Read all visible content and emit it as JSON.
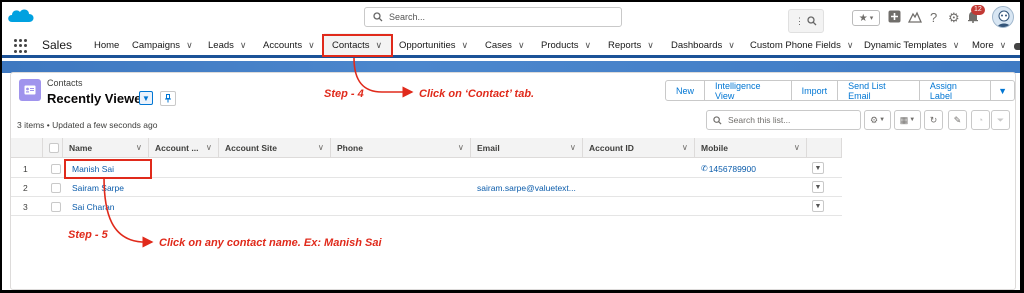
{
  "search": {
    "placeholder": "Search..."
  },
  "app": {
    "name": "Sales"
  },
  "notifications": {
    "count": "12"
  },
  "nav": {
    "items": [
      {
        "label": "Home",
        "chevron": false
      },
      {
        "label": "Campaigns",
        "chevron": true
      },
      {
        "label": "Leads",
        "chevron": true
      },
      {
        "label": "Accounts",
        "chevron": true
      },
      {
        "label": "Contacts",
        "chevron": true,
        "active": true
      },
      {
        "label": "Opportunities",
        "chevron": true
      },
      {
        "label": "Cases",
        "chevron": true
      },
      {
        "label": "Products",
        "chevron": true
      },
      {
        "label": "Reports",
        "chevron": true
      },
      {
        "label": "Dashboards",
        "chevron": true
      },
      {
        "label": "Custom Phone Fields",
        "chevron": true
      },
      {
        "label": "Dynamic Templates",
        "chevron": true
      },
      {
        "label": "More",
        "chevron": true
      }
    ]
  },
  "list": {
    "object_label": "Contacts",
    "view_name": "Recently Viewed",
    "status": "3 items • Updated a few seconds ago",
    "search_placeholder": "Search this list...",
    "buttons": [
      "New",
      "Intelligence View",
      "Import",
      "Send List Email",
      "Assign Label"
    ],
    "columns": [
      "Name",
      "Account ...",
      "Account Site",
      "Phone",
      "Email",
      "Account ID",
      "Mobile"
    ],
    "rows": [
      {
        "num": "1",
        "name": "Manish Sai",
        "email": "",
        "mobile": "1456789900"
      },
      {
        "num": "2",
        "name": "Sairam Sarpe",
        "email": "sairam.sarpe@valuetext...",
        "mobile": ""
      },
      {
        "num": "3",
        "name": "Sai Charan",
        "email": "",
        "mobile": ""
      }
    ]
  },
  "annotations": {
    "step4": "Step - 4",
    "click4": "Click on ‘Contact’ tab.",
    "step5": "Step - 5",
    "click5": "Click on any contact name.   Ex: Manish Sai",
    "color": "#e02a1b"
  },
  "colors": {
    "brand_blue": "#1b5297",
    "link": "#0b5cab",
    "accent": "#0176d3",
    "icon_purple": "#a094ed"
  }
}
